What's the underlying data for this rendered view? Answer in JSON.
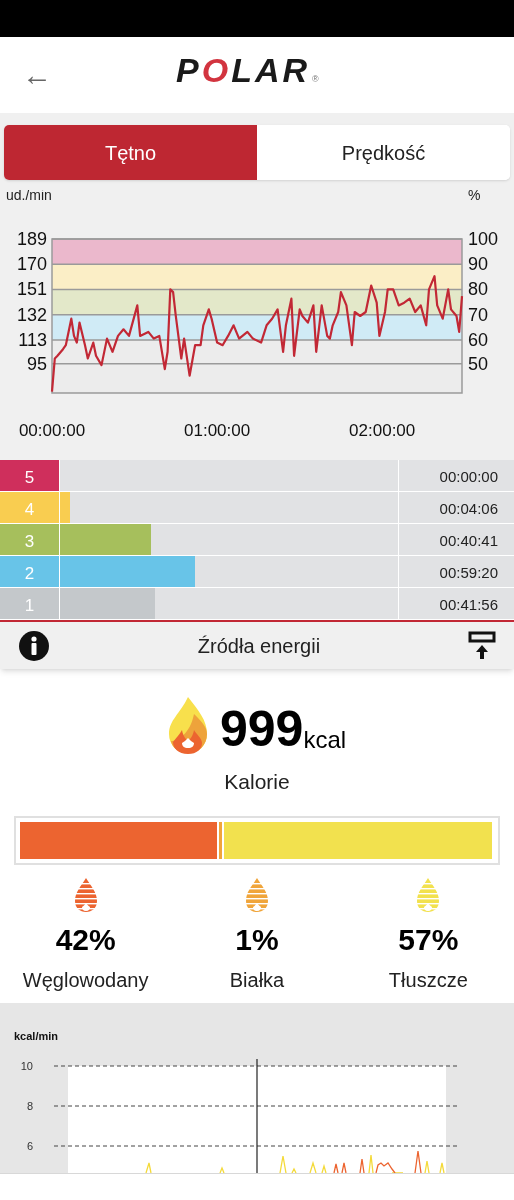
{
  "header": {
    "back_icon": "←",
    "logo": "POLAR",
    "trademark": "®"
  },
  "tabs": [
    {
      "label": "Tętno",
      "selected": true
    },
    {
      "label": "Prędkość",
      "selected": false
    }
  ],
  "hr_chart": {
    "left_unit": "ud./min",
    "right_unit": "%",
    "right_ticks": [
      "100",
      "90",
      "80",
      "70",
      "60",
      "50"
    ],
    "chart_data": {
      "type": "line",
      "grid": true,
      "bands": [
        {
          "axis": "y",
          "from": 170,
          "to": 189,
          "color": "#ebb8cc"
        },
        {
          "axis": "y",
          "from": 151,
          "to": 170,
          "color": "#fbeec6"
        },
        {
          "axis": "y",
          "from": 132,
          "to": 151,
          "color": "#e3e8c9"
        },
        {
          "axis": "y",
          "from": 113,
          "to": 132,
          "color": "#d0ebf6"
        }
      ],
      "xlim": [
        0,
        149
      ],
      "ylim": [
        73,
        189
      ],
      "yticks": [
        95,
        113,
        132,
        151,
        170,
        189
      ],
      "xticks": [
        {
          "value": 0,
          "label": "00:00:00"
        },
        {
          "value": 60,
          "label": "01:00:00"
        },
        {
          "value": 120,
          "label": "02:00:00"
        }
      ],
      "x": [
        0,
        1,
        2,
        4,
        5,
        7,
        8,
        9,
        10,
        12,
        13,
        15,
        16,
        18,
        20,
        22,
        24,
        26,
        28,
        31,
        32,
        35,
        37,
        39,
        41,
        42,
        43,
        44,
        45,
        47,
        48,
        50,
        52,
        54,
        55,
        57,
        58,
        60,
        62,
        64,
        66,
        68,
        71,
        73,
        76,
        78,
        80,
        82,
        84,
        85,
        87,
        88,
        90,
        91,
        93,
        95,
        96,
        98,
        100,
        101,
        102,
        104,
        105,
        107,
        109,
        110,
        112,
        114,
        116,
        118,
        119,
        121,
        122,
        124,
        126,
        128,
        130,
        132,
        134,
        136,
        137,
        139,
        140,
        142,
        144,
        145,
        147,
        148,
        149
      ],
      "series": [
        {
          "color": "#c22835",
          "values": [
            74,
            99,
            101,
            106,
            109,
            129,
            116,
            111,
            126,
            109,
            99,
            111,
            101,
            94,
            114,
            104,
            116,
            121,
            116,
            139,
            116,
            119,
            114,
            116,
            91,
            104,
            151,
            149,
            131,
            99,
            114,
            86,
            109,
            109,
            124,
            136,
            129,
            111,
            109,
            116,
            124,
            114,
            119,
            114,
            111,
            124,
            129,
            136,
            104,
            124,
            144,
            101,
            136,
            131,
            126,
            139,
            104,
            139,
            116,
            114,
            124,
            134,
            149,
            139,
            109,
            134,
            131,
            134,
            154,
            141,
            116,
            134,
            151,
            151,
            139,
            141,
            144,
            134,
            139,
            124,
            151,
            161,
            139,
            129,
            151,
            136,
            131,
            119,
            146
          ]
        }
      ]
    }
  },
  "zones": [
    {
      "number": "5",
      "color": "#cf2f5c",
      "level": 0.148,
      "time": "00:00:00"
    },
    {
      "number": "4",
      "color": "#f9cd50",
      "level": 0.176,
      "time": "00:04:06"
    },
    {
      "number": "3",
      "color": "#a6bf5c",
      "level": 0.379,
      "time": "00:40:41"
    },
    {
      "number": "2",
      "color": "#68c4e8",
      "level": 0.49,
      "time": "00:59:20"
    },
    {
      "number": "1",
      "color": "#c4c8cb",
      "level": 0.389,
      "time": "00:41:56"
    }
  ],
  "energy_header": {
    "title": "Źródła energii"
  },
  "calories": {
    "value": "999",
    "unit": "kcal",
    "label": "Kalorie"
  },
  "sources": [
    {
      "percent": "42%",
      "name": "Węglowodany",
      "color": "#ec6430",
      "level": 0.42
    },
    {
      "percent": "1%",
      "name": "Białka",
      "color": "#f0a53b",
      "level": 0.01
    },
    {
      "percent": "57%",
      "name": "Tłuszcze",
      "color": "#f2e14e",
      "level": 0.57
    }
  ],
  "kcal_chart": {
    "unit": "kcal/min",
    "tick_labels": [
      "10",
      "8",
      "6"
    ]
  }
}
